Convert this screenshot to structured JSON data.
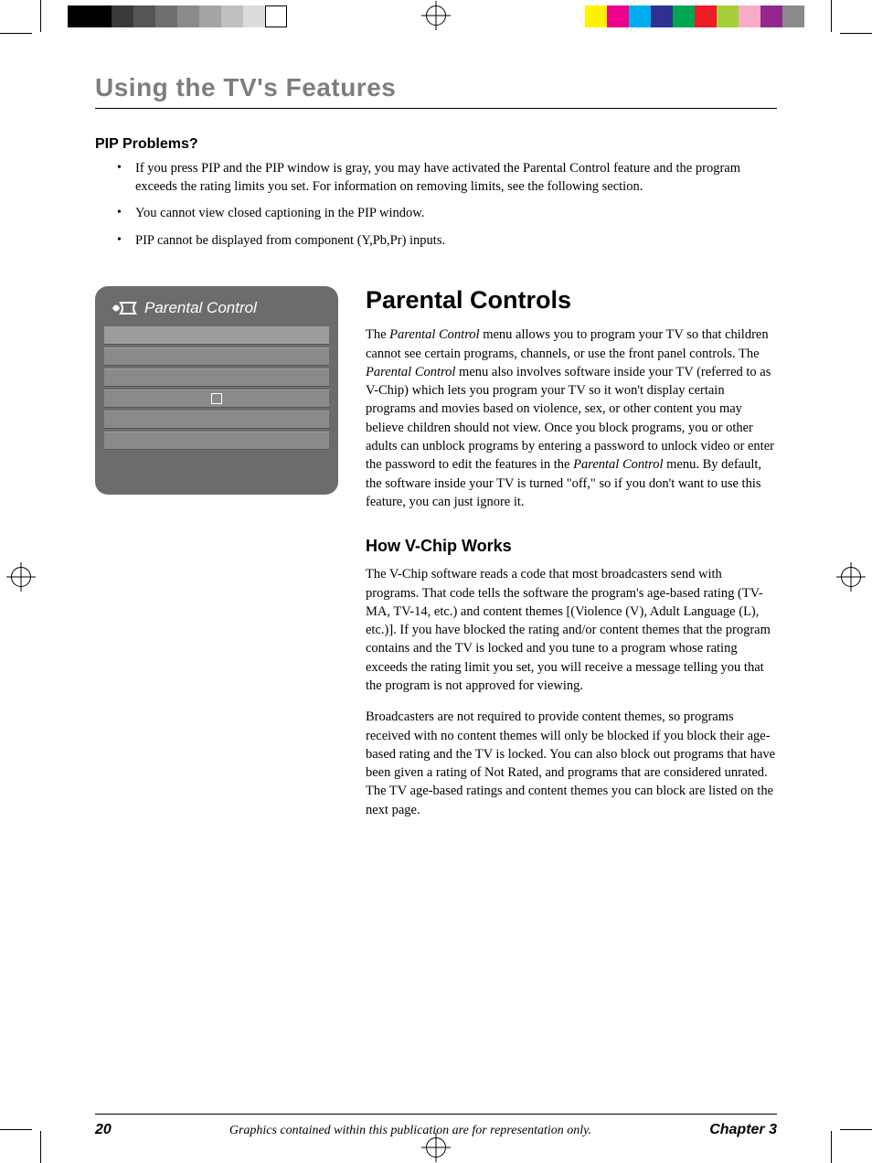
{
  "header": {
    "title": "Using the TV's Features"
  },
  "pip": {
    "heading": "PIP Problems?",
    "items": [
      "If you press PIP and the PIP window is gray, you may have activated the Parental Control feature and the program exceeds the rating limits you set. For information on removing limits, see the following section.",
      "You cannot view closed captioning in the PIP window.",
      "PIP cannot be displayed from component (Y,Pb,Pr) inputs."
    ]
  },
  "panel": {
    "title": "Parental Control"
  },
  "parental": {
    "heading": "Parental Controls",
    "para_prefix": "The ",
    "para_em1": "Parental Control",
    "para_mid1": " menu allows you to program your TV so that children cannot see certain programs, channels, or use the front panel controls. The ",
    "para_em2": "Parental Control",
    "para_mid2": " menu also involves software inside your TV (referred to as V-Chip) which lets you program your TV so it won't display certain programs and movies based on violence, sex, or other content you may believe children should not view. Once you block programs, you or other adults can unblock programs by entering a password to unlock video or enter the password to edit the features in the ",
    "para_em3": "Parental Control",
    "para_end": " menu. By default, the software inside your TV is turned \"off,\" so if you don't want to use this feature, you can just ignore it."
  },
  "vchip": {
    "heading": "How V-Chip Works",
    "p1": "The V-Chip software reads a code that most broadcasters send with programs. That code tells the software the program's age-based rating (TV-MA, TV-14, etc.) and content themes [(Violence (V), Adult Language (L), etc.)]. If you have blocked the rating and/or content themes that the program contains and the TV is locked and you tune to a program whose rating exceeds the rating limit you set, you will receive a message telling you that the program is not approved for viewing.",
    "p2": "Broadcasters are not required to provide content themes, so programs received with no content themes will only be blocked if you block their age-based rating and the TV is locked. You can also block out programs that have been given a rating of Not Rated, and programs that are considered unrated. The TV age-based ratings and content themes you can block are listed on the next page."
  },
  "footer": {
    "page": "20",
    "note": "Graphics contained within this publication are for representation only.",
    "chapter": "Chapter 3"
  },
  "colorbars": {
    "left": [
      "#000000",
      "#000000",
      "#3a3a3a",
      "#555555",
      "#707070",
      "#8a8a8a",
      "#a5a5a5",
      "#c0c0c0",
      "#dcdcdc",
      "#ffffff"
    ],
    "right": [
      "#fff200",
      "#ec008c",
      "#00aeef",
      "#2e3192",
      "#00a651",
      "#ed1c24",
      "#a6ce39",
      "#f7adc9",
      "#92278f",
      "#8a8a8a"
    ]
  }
}
